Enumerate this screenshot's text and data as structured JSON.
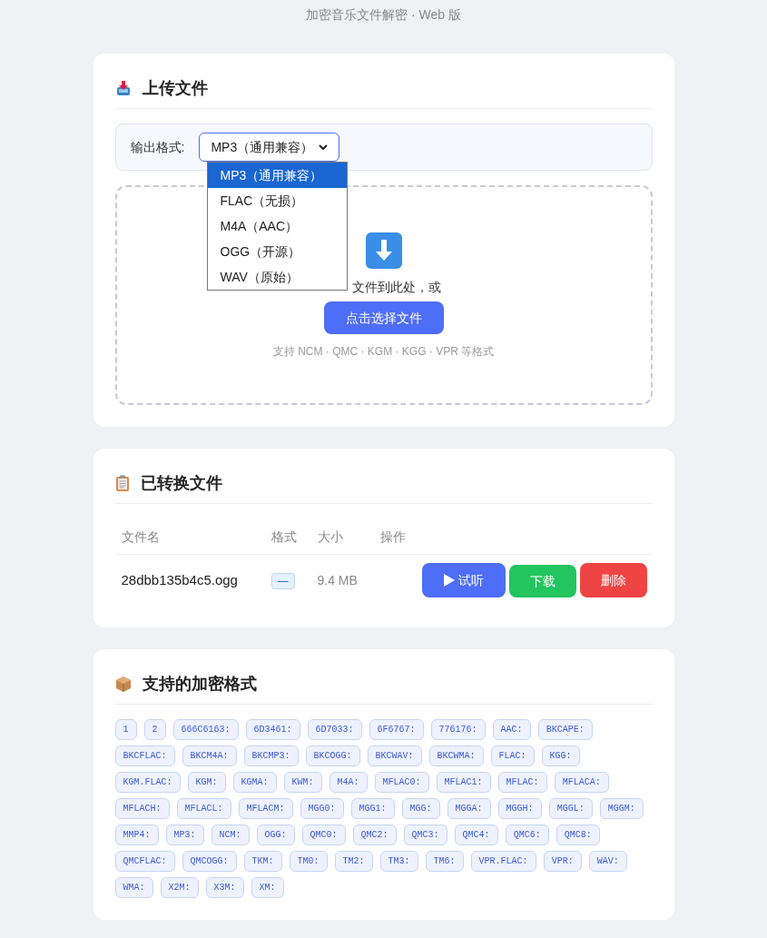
{
  "header": {
    "title": "加密音乐文件解密 · Web 版"
  },
  "upload": {
    "title": "上传文件",
    "format_label": "输出格式:",
    "select_value": "MP3（通用兼容）",
    "options": [
      {
        "label": "MP3（通用兼容）",
        "selected": true
      },
      {
        "label": "FLAC（无损）",
        "selected": false
      },
      {
        "label": "M4A（AAC）",
        "selected": false
      },
      {
        "label": "OGG（开源）",
        "selected": false
      },
      {
        "label": "WAV（原始）",
        "selected": false
      }
    ],
    "drop_text": "文件到此处，或",
    "choose_button": "点击选择文件",
    "hint": "支持 NCM · QMC · KGM · KGG · VPR 等格式"
  },
  "converted": {
    "title": "已转换文件",
    "columns": [
      "文件名",
      "格式",
      "大小",
      "操作"
    ],
    "rows": [
      {
        "name": "28dbb135b4c5.ogg",
        "format": "—",
        "size": "9.4 MB",
        "play": "试听",
        "download": "下载",
        "delete": "删除"
      }
    ]
  },
  "formats": {
    "title": "支持的加密格式",
    "tags": [
      "1",
      "2",
      "666C6163:",
      "6D3461:",
      "6D7033:",
      "6F6767:",
      "776176:",
      "AAC:",
      "BKCAPE:",
      "BKCFLAC:",
      "BKCM4A:",
      "BKCMP3:",
      "BKCOGG:",
      "BKCWAV:",
      "BKCWMA:",
      "FLAC:",
      "KGG:",
      "KGM.FLAC:",
      "KGM:",
      "KGMA:",
      "KWM:",
      "M4A:",
      "MFLAC0:",
      "MFLAC1:",
      "MFLAC:",
      "MFLACA:",
      "MFLACH:",
      "MFLACL:",
      "MFLACM:",
      "MGG0:",
      "MGG1:",
      "MGG:",
      "MGGA:",
      "MGGH:",
      "MGGL:",
      "MGGM:",
      "MMP4:",
      "MP3:",
      "NCM:",
      "OGG:",
      "QMC0:",
      "QMC2:",
      "QMC3:",
      "QMC4:",
      "QMC6:",
      "QMC8:",
      "QMCFLAC:",
      "QMCOGG:",
      "TKM:",
      "TM0:",
      "TM2:",
      "TM3:",
      "TM6:",
      "VPR.FLAC:",
      "VPR:",
      "WAV:",
      "WMA:",
      "X2M:",
      "X3M:",
      "XM:"
    ]
  }
}
